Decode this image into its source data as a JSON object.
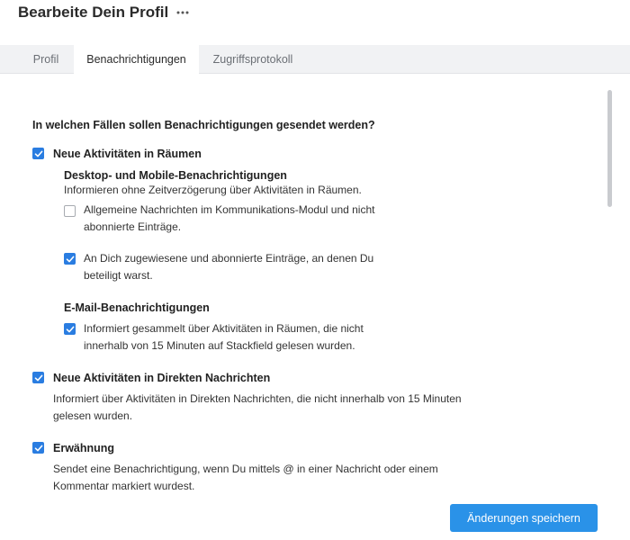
{
  "header": {
    "title": "Bearbeite Dein Profil",
    "more_icon": "more-horizontal-icon"
  },
  "tabs": [
    {
      "label": "Profil",
      "active": false
    },
    {
      "label": "Benachrichtigungen",
      "active": true
    },
    {
      "label": "Zugriffsprotokoll",
      "active": false
    }
  ],
  "main": {
    "question": "In welchen Fällen sollen Benachrichtigungen gesendet werden?",
    "rooms": {
      "label": "Neue Aktivitäten in Räumen",
      "checked": true,
      "desktop": {
        "heading": "Desktop- und Mobile-Benachrichtigungen",
        "description": "Informieren ohne Zeitverzögerung über Aktivitäten in Räumen.",
        "options": [
          {
            "line1": "Allgemeine Nachrichten im Kommunikations-Modul und nicht",
            "line2": "abonnierte Einträge.",
            "checked": false
          },
          {
            "line1": "An Dich zugewiesene und abonnierte Einträge, an denen Du",
            "line2": "beteiligt warst.",
            "checked": true
          }
        ]
      },
      "email": {
        "heading": "E-Mail-Benachrichtigungen",
        "option": {
          "line1": "Informiert gesammelt über Aktivitäten in Räumen, die nicht",
          "line2": "innerhalb von 15 Minuten auf Stackfield gelesen wurden.",
          "checked": true
        }
      }
    },
    "direct": {
      "label": "Neue Aktivitäten in Direkten Nachrichten",
      "checked": true,
      "line1": "Informiert über Aktivitäten in Direkten Nachrichten, die nicht innerhalb von 15 Minuten",
      "line2": "gelesen wurden."
    },
    "mention": {
      "label": "Erwähnung",
      "checked": true,
      "line1": "Sendet eine Benachrichtigung, wenn Du mittels @ in einer Nachricht oder einem",
      "line2": "Kommentar markiert wurdest."
    },
    "save_label": "Änderungen speichern"
  },
  "colors": {
    "accent": "#2a7de1",
    "button": "#2a92e8",
    "tabbar": "#f1f2f4"
  }
}
